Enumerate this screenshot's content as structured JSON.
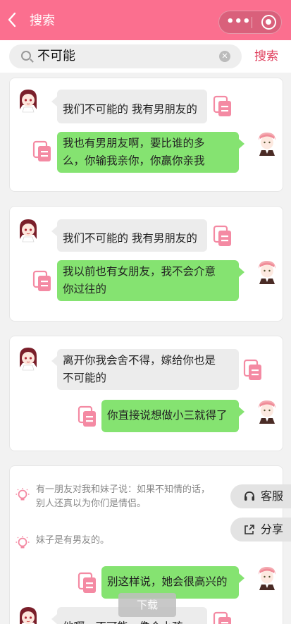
{
  "header": {
    "back_icon": "chevron-left-icon",
    "title": "搜索"
  },
  "search": {
    "value": "不可能",
    "button_label": "搜索"
  },
  "cards": [
    {
      "messages": [
        {
          "side": "in",
          "lines": [
            "我们不可能的 我有男朋友的"
          ]
        },
        {
          "side": "out",
          "lines": [
            "我也有男朋友啊，要比谁的多",
            "么，你输我亲你，你赢你亲我"
          ]
        }
      ]
    },
    {
      "messages": [
        {
          "side": "in",
          "lines": [
            "我们不可能的 我有男朋友的"
          ]
        },
        {
          "side": "out",
          "lines": [
            "我以前也有女朋友，我不会介意",
            "你过往的"
          ]
        }
      ]
    },
    {
      "messages": [
        {
          "side": "in",
          "lines": [
            "离开你我会舍不得，嫁给你也是",
            "不可能的"
          ]
        },
        {
          "side": "out",
          "lines": [
            "你直接说想做小三就得了"
          ]
        }
      ]
    },
    {
      "tips": [
        {
          "lines": [
            "有一朋友对我和妹子说：如果不知情的话，",
            "别人还真以为你们是情侣。"
          ]
        },
        {
          "lines": [
            "妹子是有男友的。"
          ]
        }
      ],
      "messages": [
        {
          "side": "out",
          "lines": [
            "别这样说，她会很高兴的"
          ]
        },
        {
          "side": "in",
          "lines": [
            "他啊，不可能，像个小孩"
          ]
        }
      ]
    }
  ],
  "floating": {
    "service_label": "客服",
    "share_label": "分享",
    "download_label": "下载"
  },
  "colors": {
    "brand": "#fb6f8f",
    "bubble_out": "#85e371",
    "bubble_in": "#ececec",
    "accent": "#e0415f"
  }
}
